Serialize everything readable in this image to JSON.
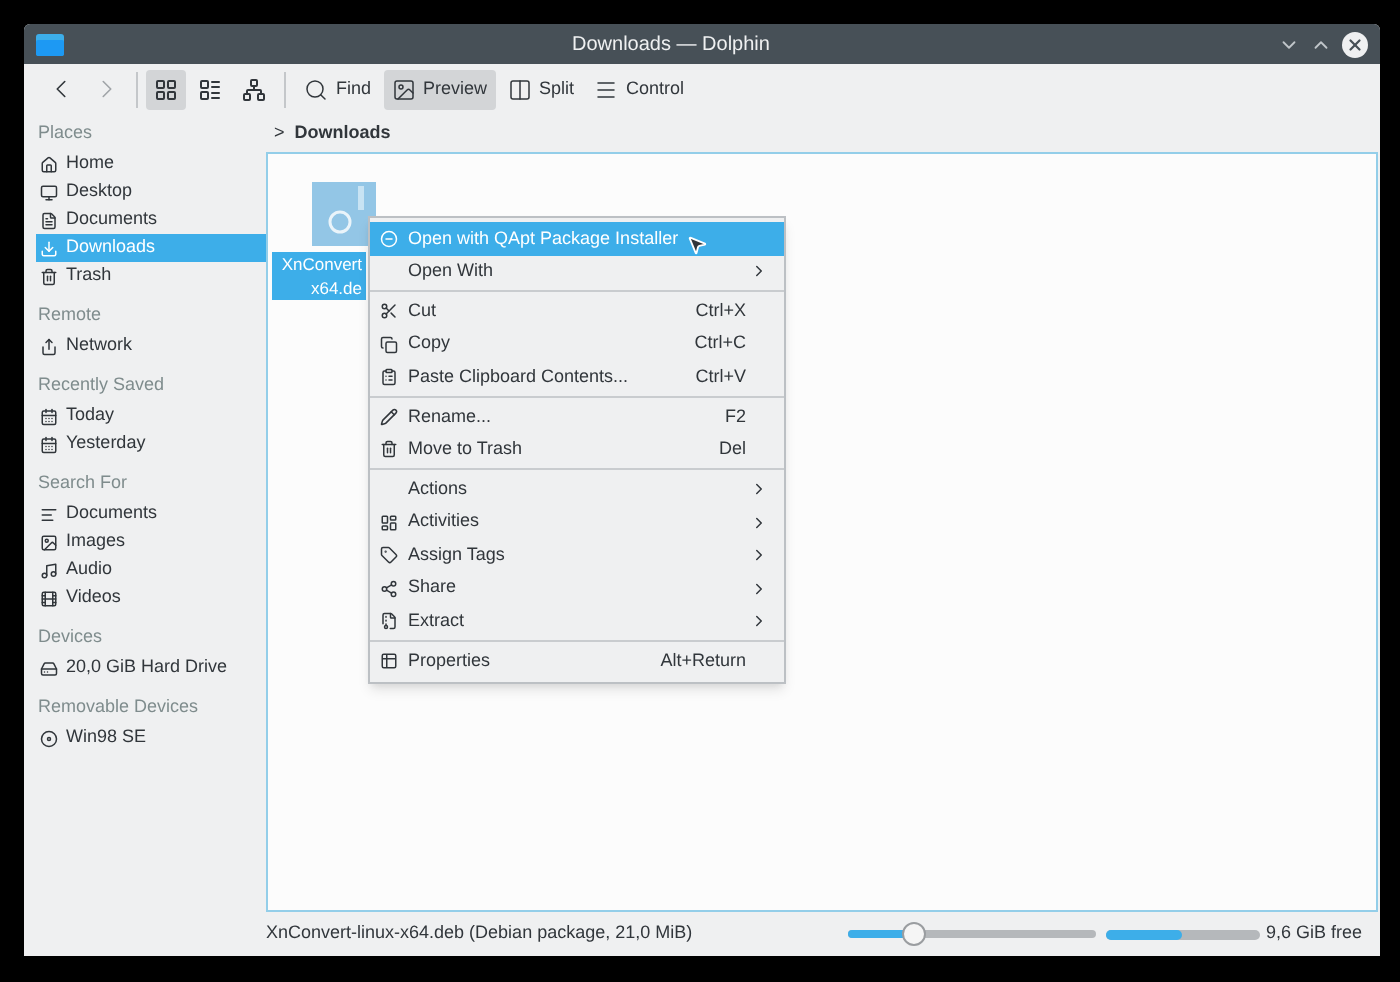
{
  "window": {
    "title": "Downloads — Dolphin"
  },
  "toolbar": {
    "view_modes": [
      {
        "selected": true
      },
      {
        "selected": false
      },
      {
        "selected": false
      }
    ],
    "buttons": [
      {
        "label": "Find",
        "selected": false
      },
      {
        "label": "Preview",
        "selected": true
      },
      {
        "label": "Split",
        "selected": false
      },
      {
        "label": "Control",
        "selected": false
      }
    ]
  },
  "sidebar": {
    "sections": [
      {
        "title": "Places",
        "items": [
          {
            "label": "Home",
            "selected": false
          },
          {
            "label": "Desktop",
            "selected": false
          },
          {
            "label": "Documents",
            "selected": false
          },
          {
            "label": "Downloads",
            "selected": true
          },
          {
            "label": "Trash",
            "selected": false
          }
        ]
      },
      {
        "title": "Remote",
        "items": [
          {
            "label": "Network",
            "selected": false
          }
        ]
      },
      {
        "title": "Recently Saved",
        "items": [
          {
            "label": "Today",
            "selected": false
          },
          {
            "label": "Yesterday",
            "selected": false
          }
        ]
      },
      {
        "title": "Search For",
        "items": [
          {
            "label": "Documents",
            "selected": false
          },
          {
            "label": "Images",
            "selected": false
          },
          {
            "label": "Audio",
            "selected": false
          },
          {
            "label": "Videos",
            "selected": false
          }
        ]
      },
      {
        "title": "Devices",
        "items": [
          {
            "label": "20,0 GiB Hard Drive",
            "selected": false
          }
        ]
      },
      {
        "title": "Removable Devices",
        "items": [
          {
            "label": "Win98 SE",
            "selected": false
          }
        ]
      }
    ]
  },
  "breadcrumb": {
    "separator": ">",
    "current": "Downloads"
  },
  "file": {
    "name_lines": [
      "XnConvert",
      "x64.de"
    ],
    "selected": true
  },
  "context_menu": {
    "sections": [
      [
        {
          "label": "Open with QApt Package Installer",
          "selected": true
        },
        {
          "label": "Open With",
          "submenu": true,
          "selected": false
        }
      ],
      [
        {
          "label": "Cut",
          "shortcut": "Ctrl+X",
          "selected": false
        },
        {
          "label": "Copy",
          "shortcut": "Ctrl+C",
          "selected": false
        },
        {
          "label": "Paste Clipboard Contents...",
          "shortcut": "Ctrl+V",
          "selected": false
        }
      ],
      [
        {
          "label": "Rename...",
          "shortcut": "F2",
          "selected": false
        },
        {
          "label": "Move to Trash",
          "shortcut": "Del",
          "selected": false
        }
      ],
      [
        {
          "label": "Actions",
          "submenu": true,
          "selected": false
        },
        {
          "label": "Activities",
          "submenu": true,
          "selected": false
        },
        {
          "label": "Assign Tags",
          "submenu": true,
          "selected": false
        },
        {
          "label": "Share",
          "submenu": true,
          "selected": false
        },
        {
          "label": "Extract",
          "submenu": true,
          "selected": false
        }
      ],
      [
        {
          "label": "Properties",
          "shortcut": "Alt+Return",
          "selected": false
        }
      ]
    ]
  },
  "status_bar": {
    "text": "XnConvert-linux-x64.deb (Debian package, 21,0 MiB)",
    "zoom": {
      "level": 0.27
    },
    "space": {
      "level": 0.5
    },
    "free": "9,6 GiB free"
  }
}
